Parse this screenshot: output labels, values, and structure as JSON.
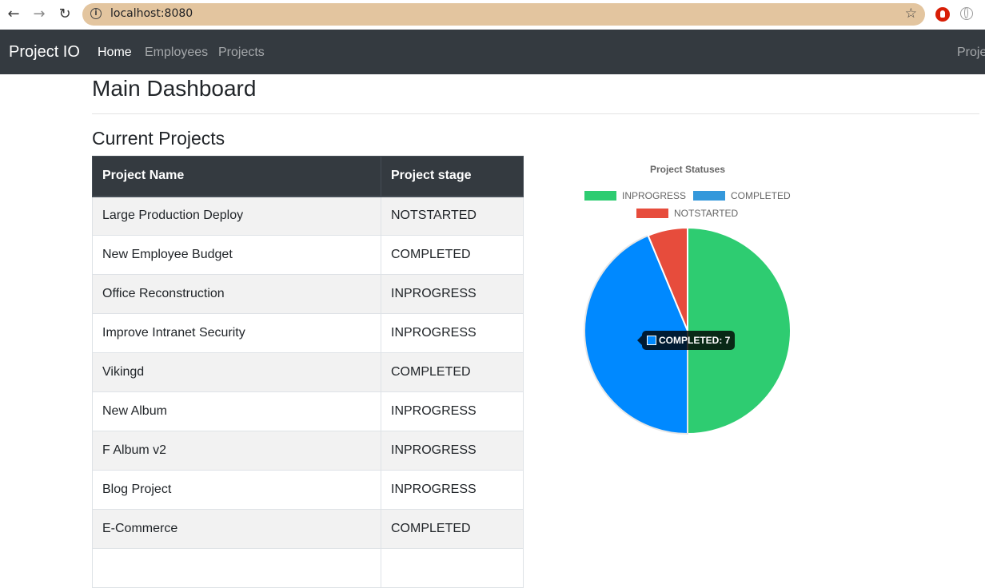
{
  "browser": {
    "back_icon": "←",
    "forward_icon": "→",
    "reload_icon": "↻",
    "url": "localhost:8080",
    "info_icon": "i",
    "star_icon": "☆"
  },
  "navbar": {
    "brand": "Project IO",
    "links": [
      "Home",
      "Employees",
      "Projects"
    ],
    "active_link": "Home",
    "right_link": "Proje"
  },
  "page": {
    "title": "Main Dashboard",
    "section_title": "Current Projects"
  },
  "table": {
    "headers": [
      "Project Name",
      "Project stage"
    ],
    "rows": [
      [
        "Large Production Deploy",
        "NOTSTARTED"
      ],
      [
        "New Employee Budget",
        "COMPLETED"
      ],
      [
        "Office Reconstruction",
        "INPROGRESS"
      ],
      [
        "Improve Intranet Security",
        "INPROGRESS"
      ],
      [
        "Vikingd",
        "COMPLETED"
      ],
      [
        "New Album",
        "INPROGRESS"
      ],
      [
        "F Album v2",
        "INPROGRESS"
      ],
      [
        "Blog Project",
        "INPROGRESS"
      ],
      [
        "E-Commerce",
        "COMPLETED"
      ],
      [
        "",
        ""
      ]
    ]
  },
  "chart_data": {
    "type": "pie",
    "title": "Project Statuses",
    "legend_placement": "top",
    "categories": [
      "INPROGRESS",
      "COMPLETED",
      "NOTSTARTED"
    ],
    "values": [
      8,
      7,
      1
    ],
    "colors": [
      "#2ecc71",
      "#3498db",
      "#e74c3c"
    ],
    "hover_color": "#0089ff",
    "tooltip": "COMPLETED: 7"
  }
}
